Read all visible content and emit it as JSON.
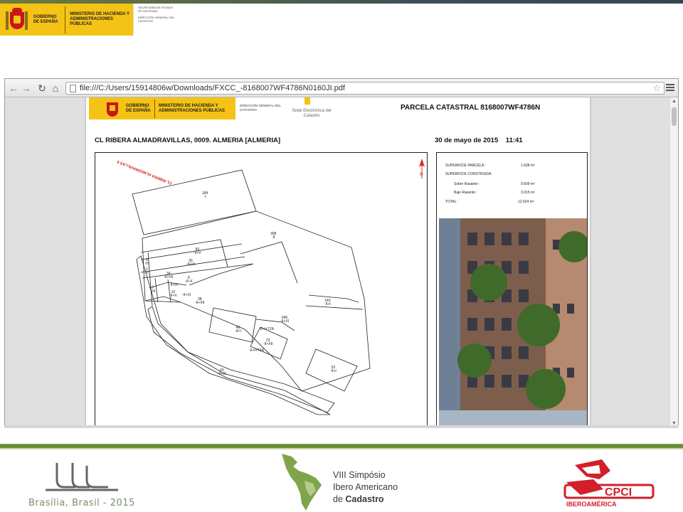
{
  "header_logo": {
    "line1": "GOBIERNO DE ESPAÑA",
    "line2": "MINISTERIO DE HACIENDA Y ADMINISTRACIONES PÚBLICAS",
    "line3": "SECRETARÍA DE ESTADO DE HACIENDA",
    "line4": "DIRECCIÓN GENERAL DEL CATASTRO"
  },
  "browser": {
    "url": "file:///C:/Users/15914806w/Downloads/FXCC_-8168007WF4786N0160JI.pdf",
    "back_icon": "←",
    "forward_icon": "→",
    "reload_icon": "↻",
    "home_icon": "⌂",
    "star_icon": "☆"
  },
  "pdf": {
    "logo_line1": "GOBIERNO DE ESPAÑA",
    "logo_line2": "MINISTERIO DE HACIENDA Y ADMINISTRACIONES PÚBLICAS",
    "dg": "DIRECCIÓN GENERAL DEL CATASTRO",
    "sede": "Sede Electrónica del Catastro",
    "title": "PARCELA CATASTRAL 8168007WF4786N",
    "address": "CL RIBERA ALMADRAVILLAS, 0009. ALMERIA [ALMERIA]",
    "date": "30 de mayo de 2015    11:41",
    "street_label": "CL RIBERA ALMADRAVILLAS 9",
    "info": {
      "superficie_parcela_label": "SUPERFICIE PARCELA :",
      "superficie_parcela_value": "1.608 m²",
      "superficie_construida_label": "SUPERFICIE CONSTRUIDA",
      "sobre_rasante_label": "Sobre Rasante :",
      "sobre_rasante_value": "9.609 m²",
      "bajo_rasante_label": "Bajo Rasante :",
      "bajo_rasante_value": "3.015 m²",
      "total_label": "TOTAL :",
      "total_value": "12.624 m²"
    },
    "map_labels": {
      "l184": "184\n-I",
      "l308": "308\n-II",
      "l60a": "60\n-II+V",
      "l36": "36\n-II+VI",
      "l34": "34\n-II+VII",
      "l8": "8\n-II+X",
      "lix": "-II+IX",
      "l12": "12\n-II+X",
      "lxi": "-II+XI",
      "l38": "38\n-II+XII",
      "l143": "143\n-II+I",
      "l645": "645\n-II+XI",
      "l48": "48\n-II+I",
      "ltza": "-II+I+TZA",
      "l23": "23\n-II+XII",
      "ltza2": "-II+I+TZA",
      "l53": "53\n-II+I",
      "l60b": "60\n-II+IX",
      "l4": "4\nVI",
      "l2": "2\nVI",
      "l7": "7\nVII"
    }
  },
  "footer": {
    "brasilia": "Brasília, Brasil - 2015",
    "simposio_line1": "VIII Simpósio",
    "simposio_line2": "Ibero Americano",
    "simposio_line3_de": "de ",
    "simposio_line3_cad": "Cadastro",
    "cpci_text": "CPCI",
    "cpci_sub": "IBEROAMÉRICA"
  },
  "colors": {
    "gov_yellow": "#f4c316",
    "gov_red": "#c8161d",
    "band_green": "#6a8c36"
  }
}
